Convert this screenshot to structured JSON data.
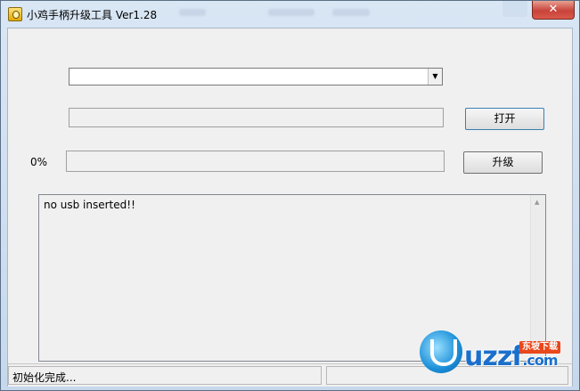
{
  "window": {
    "title": "小鸡手柄升级工具 Ver1.28",
    "close_glyph": "✕"
  },
  "device_select": {
    "value": ""
  },
  "file_path": {
    "value": ""
  },
  "open_button": {
    "label": "打开"
  },
  "progress": {
    "percent_label": "0%",
    "value": 0
  },
  "upgrade_button": {
    "label": "升级"
  },
  "log": {
    "text": "no usb inserted!!"
  },
  "statusbar": {
    "message": "初始化完成...",
    "secondary": ""
  },
  "watermark": {
    "brand": "uzzf",
    "suffix": ".com",
    "badge": "东坡下载"
  }
}
